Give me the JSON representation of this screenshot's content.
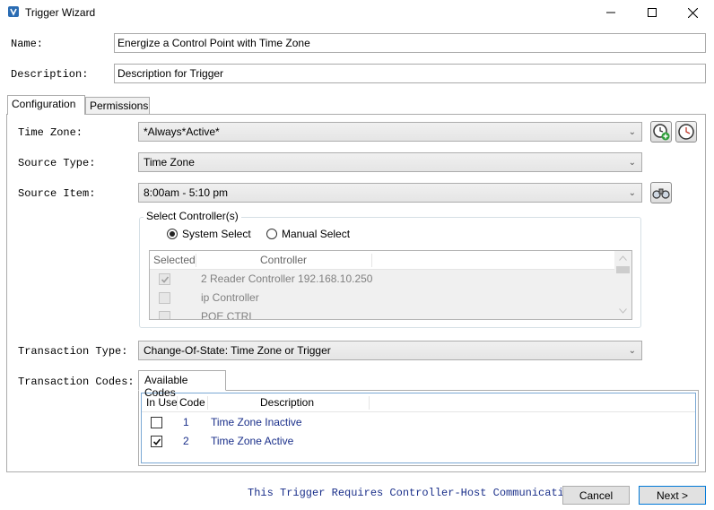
{
  "window": {
    "title": "Trigger Wizard"
  },
  "form": {
    "name_label": "Name:",
    "name_value": "Energize a Control Point with Time Zone",
    "description_label": "Description:",
    "description_value": "Description for Trigger"
  },
  "tabs": [
    {
      "label": "Configuration"
    },
    {
      "label": "Permissions"
    }
  ],
  "config": {
    "time_zone_label": "Time Zone:",
    "time_zone_value": "*Always*Active*",
    "source_type_label": "Source Type:",
    "source_type_value": "Time Zone",
    "source_item_label": "Source Item:",
    "source_item_value": "8:00am - 5:10 pm",
    "select_controllers": {
      "legend": "Select Controller(s)",
      "system_select": "System Select",
      "manual_select": "Manual Select",
      "selected_option": "System Select",
      "columns": [
        "Selected",
        "Controller"
      ],
      "rows": [
        {
          "selected": true,
          "controller": "2 Reader Controller 192.168.10.250"
        },
        {
          "selected": false,
          "controller": "ip Controller"
        },
        {
          "selected": false,
          "controller": "POE CTRL"
        }
      ]
    },
    "transaction_type_label": "Transaction Type:",
    "transaction_type_value": "Change-Of-State: Time Zone or Trigger",
    "transaction_codes_label": "Transaction Codes:",
    "available_codes_tab": "Available Codes",
    "codes_columns": [
      "In Use",
      "Code",
      "Description"
    ],
    "codes": [
      {
        "in_use": false,
        "code": "1",
        "description": "Time Zone Inactive"
      },
      {
        "in_use": true,
        "code": "2",
        "description": "Time Zone Active"
      }
    ]
  },
  "footer": {
    "note": "This Trigger Requires Controller-Host Communication",
    "cancel_label": "Cancel",
    "next_label": "Next >"
  },
  "colors": {
    "accent": "#0078d7",
    "link_text": "#1a2f8a"
  }
}
